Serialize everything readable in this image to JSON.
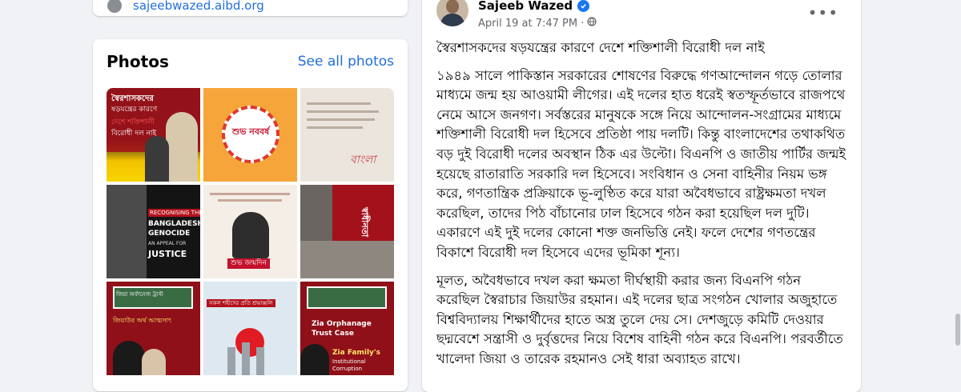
{
  "intro": {
    "website": "sajeebwazed.aibd.org"
  },
  "photos": {
    "title": "Photos",
    "see_all": "See all photos",
    "tiles": [
      {
        "line1": "স্বৈরশাসকদের",
        "line2": "ষড়যন্ত্রের কারণে",
        "line3": "দেশে শক্তিশালী",
        "line4": "বিরোধী দল নাই"
      },
      {
        "text": "শুভ নববর্ষ"
      },
      {
        "text": "বাংলা"
      },
      {
        "line1": "RECOGNISING THE",
        "line2": "BANGLADESH",
        "line3": "GENOCIDE",
        "line4": "AN APPEAL FOR",
        "line5": "JUSTICE"
      },
      {
        "line1": "শুভ জন্মদিন"
      },
      {
        "text": "স্বাধীনতা"
      },
      {
        "line1": "জিয়া অর্ফানেজ ট্রাস্ট",
        "line2": "জিয়াউর অর্থ আত্মসাৎ"
      },
      {
        "line1": "সকল শহীদের প্রতি শ্রদ্ধাঞ্জলি"
      },
      {
        "line1": "Zia Orphanage",
        "line2": "Trust Case",
        "line3": "Zia Family's",
        "line4": "Institutional",
        "line5": "Corruption"
      }
    ]
  },
  "post": {
    "author": "Sajeeb Wazed",
    "date": "April 19 at 7:47 PM",
    "dot": "·",
    "paragraphs": [
      "স্বৈরশাসকদের ষড়যন্ত্রের কারণে দেশে শক্তিশালী বিরোধী দল নাই",
      "১৯৪৯ সালে পাকিস্তান সরকারের শোষণের বিরুদ্ধে গণআন্দোলন গড়ে তোলার মাধ্যমে জন্ম হয় আওয়ামী লীগের। এই দলের হাত ধরেই স্বতস্ফূর্তভাবে রাজপথে নেমে আসে জনগণ। সর্বস্তরের মানুষকে সঙ্গে নিয়ে আন্দোলন-সংগ্রামের মাধ্যমে শক্তিশালী বিরোধী দল হিসেবে প্রতিষ্ঠা পায় দলটি। কিন্তু বাংলাদেশের তথাকথিত বড় দুই বিরোধী দলের অবস্থান ঠিক এর উল্টো। বিএনপি ও জাতীয় পার্টির জন্মই হয়েছে রাতারাতি সরকারি দল হিসেবে। সংবিধান ও সেনা বাহিনীর নিয়ম ভঙ্গ করে, গণতান্ত্রিক প্রক্রিয়াকে ভূ-লুণ্ঠিত করে যারা অবৈধভাবে রাষ্ট্রক্ষমতা দখল করেছিল, তাদের পিঠ বাঁচানোর ঢাল হিসেবে গঠন করা হয়েছিল দল দুটি। একারণে এই দুই দলের কোনো শক্ত জনভিত্তি নেই। ফলে দেশের গণতন্ত্রের বিকাশে বিরোধী দল হিসেবে এদের ভূমিকা শূন্য।",
      "মূলত, অবৈধভাবে দখল করা ক্ষমতা দীর্ঘস্থায়ী করার জন্য বিএনপি গঠন করেছিল স্বৈরাচার জিয়াউর রহমান। এই দলের ছাত্র সংগঠন খোলার অজুহাতে বিশ্ববিদ্যালয় শিক্ষার্থীদের হাতে অস্ত্র তুলে দেয় সে। দেশজুড়ে কমিটি দেওয়ার ছদ্মবেশে সন্ত্রাসী ও দুর্বৃত্তদের নিয়ে বিশেষ বাহিনী গঠন করে বিএনপি। পরবর্তীতে খালেদা জিয়া ও তারেক রহমানও সেই ধারা অব্যাহত রাখে।"
    ]
  }
}
